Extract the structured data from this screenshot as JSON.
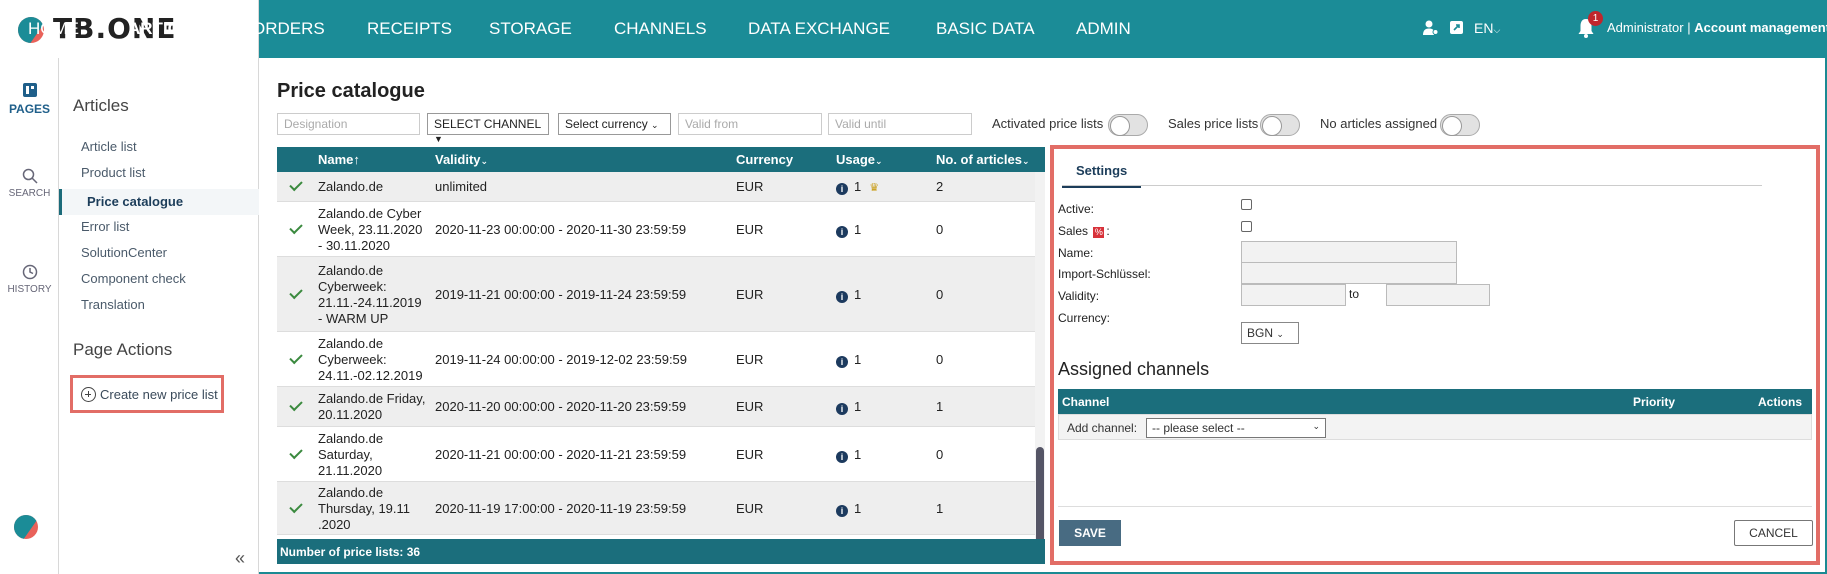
{
  "app": {
    "logo": "TB.ONE"
  },
  "nav": {
    "items": [
      {
        "label": "HOME"
      },
      {
        "label": "ARTICLES"
      },
      {
        "label": "ORDERS"
      },
      {
        "label": "RECEIPTS"
      },
      {
        "label": "STORAGE"
      },
      {
        "label": "CHANNELS"
      },
      {
        "label": "DATA EXCHANGE"
      },
      {
        "label": "BASIC DATA"
      },
      {
        "label": "ADMIN"
      }
    ],
    "active": "ARTICLES",
    "language": "EN",
    "notification_count": "1",
    "user_name": "Administrator",
    "separator": "|",
    "account_link": "Account management"
  },
  "rail": {
    "pages": "PAGES",
    "search": "SEARCH",
    "history": "HISTORY"
  },
  "sidebar": {
    "heading": "Articles",
    "links": [
      {
        "label": "Article list"
      },
      {
        "label": "Product list"
      },
      {
        "label": "Price catalogue"
      },
      {
        "label": "Error list"
      },
      {
        "label": "SolutionCenter"
      },
      {
        "label": "Component check"
      },
      {
        "label": "Translation"
      }
    ],
    "actions_heading": "Page Actions",
    "create_label": "Create new price list"
  },
  "main": {
    "title": "Price catalogue",
    "filters": {
      "designation_placeholder": "Designation",
      "channel_select": "SELECT CHANNEL",
      "currency_select": "Select currency",
      "valid_from_placeholder": "Valid from",
      "valid_until_placeholder": "Valid until"
    },
    "toggles": {
      "activated": "Activated price lists",
      "sales": "Sales price lists",
      "no_articles": "No articles assigned"
    },
    "table": {
      "columns": [
        "Name",
        "Validity",
        "Currency",
        "Usage",
        "No. of articles"
      ],
      "rows": [
        {
          "name": [
            "Zalando.de"
          ],
          "validity": "unlimited",
          "currency": "EUR",
          "usage": "1",
          "crown": true,
          "articles": "2"
        },
        {
          "name": [
            "Zalando.de Cyber",
            "Week, 23.11.2020",
            "- 30.11.2020"
          ],
          "validity": "2020-11-23 00:00:00 - 2020-11-30 23:59:59",
          "currency": "EUR",
          "usage": "1",
          "crown": false,
          "articles": "0"
        },
        {
          "name": [
            "Zalando.de",
            "Cyberweek:",
            "21.11.-24.11.2019",
            "- WARM UP"
          ],
          "validity": "2019-11-21 00:00:00 - 2019-11-24 23:59:59",
          "currency": "EUR",
          "usage": "1",
          "crown": false,
          "articles": "0"
        },
        {
          "name": [
            "Zalando.de",
            "Cyberweek:",
            "24.11.-02.12.2019"
          ],
          "validity": "2019-11-24 00:00:00 - 2019-12-02 23:59:59",
          "currency": "EUR",
          "usage": "1",
          "crown": false,
          "articles": "0"
        },
        {
          "name": [
            "Zalando.de Friday,",
            "20.11.2020"
          ],
          "validity": "2020-11-20 00:00:00 - 2020-11-20 23:59:59",
          "currency": "EUR",
          "usage": "1",
          "crown": false,
          "articles": "1"
        },
        {
          "name": [
            "Zalando.de",
            "Saturday,",
            "21.11.2020"
          ],
          "validity": "2020-11-21 00:00:00 - 2020-11-21 23:59:59",
          "currency": "EUR",
          "usage": "1",
          "crown": false,
          "articles": "0"
        },
        {
          "name": [
            "Zalando.de",
            "Thursday, 19.11",
            ".2020"
          ],
          "validity": "2020-11-19 17:00:00 - 2020-11-19 23:59:59",
          "currency": "EUR",
          "usage": "1",
          "crown": false,
          "articles": "1"
        }
      ],
      "footer": "Number of price lists: 36"
    }
  },
  "panel": {
    "tab": "Settings",
    "labels": {
      "active": "Active:",
      "sales": "Sales",
      "sales_suffix": ":",
      "name": "Name:",
      "import_key": "Import-Schlüssel:",
      "validity": "Validity:",
      "to": "to",
      "currency": "Currency:"
    },
    "currency_value": "BGN",
    "assigned_heading": "Assigned channels",
    "channel_columns": {
      "channel": "Channel",
      "priority": "Priority",
      "actions": "Actions"
    },
    "add_channel_label": "Add channel:",
    "add_channel_select": "-- please select --",
    "save": "SAVE",
    "cancel": "CANCEL"
  },
  "colors": {
    "primary": "#1b8c97",
    "table_header": "#1b6e7c",
    "highlight": "#e26d66",
    "save_button": "#486b82"
  }
}
